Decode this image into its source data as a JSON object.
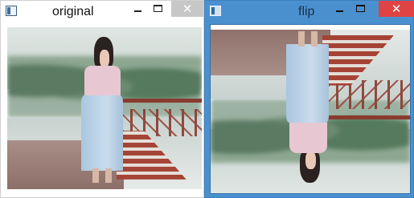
{
  "windows": {
    "original": {
      "title": "original",
      "controls": {
        "minimize": "—",
        "maximize": "☐",
        "close": "✕"
      },
      "image_alt": "photo"
    },
    "flip": {
      "title": "flip",
      "controls": {
        "minimize": "—",
        "maximize": "☐",
        "close": "✕"
      },
      "image_alt": "photo flipped vertically"
    }
  },
  "icons": {
    "app": "window-icon",
    "minimize": "minimize-icon",
    "maximize": "maximize-icon",
    "close": "close-icon"
  },
  "colors": {
    "flip_titlebar": "#4a90cf",
    "close_active": "#e04343",
    "close_inactive": "#c7c7c7",
    "railing": "#8a3b2f"
  }
}
